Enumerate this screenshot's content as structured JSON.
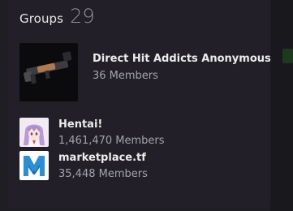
{
  "groups_section": {
    "title": "Groups",
    "count": "29",
    "items": [
      {
        "name": "Direct Hit Addicts Anonymous",
        "members": "36 Members",
        "icon": "rocket-launcher-icon"
      },
      {
        "name": "Hentai!",
        "members": "1,461,470 Members",
        "icon": "anime-avatar-icon"
      },
      {
        "name": "marketplace.tf",
        "members": "35,448 Members",
        "icon": "marketplace-m-logo-icon"
      }
    ]
  },
  "colors": {
    "panel_bg": "#221f29",
    "page_bg": "#1e1e24",
    "title_text": "#e6e6e6",
    "count_text": "#8f8f96",
    "name_text": "#ececec",
    "members_text": "#a3a3aa",
    "marketplace_brand": "#2a8fd9"
  }
}
